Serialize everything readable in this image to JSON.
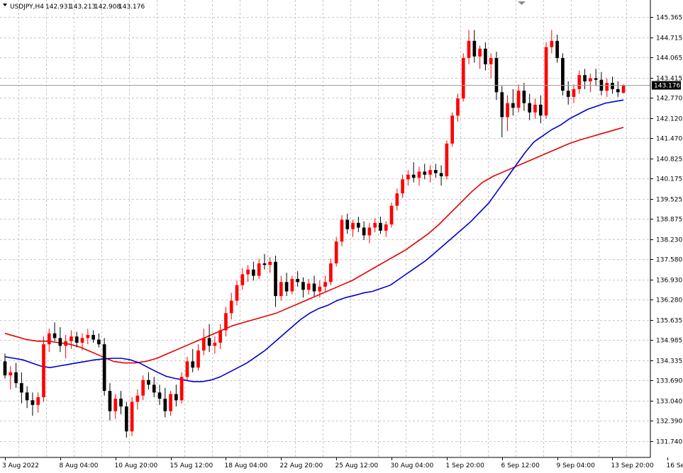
{
  "header": {
    "symbol": "USDJPY,H4",
    "open": "142.931",
    "high": "143.213",
    "low": "142.908",
    "close": "143.176"
  },
  "current_price_label": "143.176",
  "colors": {
    "background": "#ffffff",
    "grid": "#c8c8c8",
    "axis": "#000000",
    "bull_candle": "#ff0000",
    "bear_candle": "#000000",
    "ma_fast": "#0000cc",
    "ma_slow": "#e60000",
    "price_tag_bg": "#000000",
    "price_tag_text": "#ffffff"
  },
  "chart_data": {
    "type": "candlestick",
    "instrument": "USDJPY",
    "timeframe": "H4",
    "y_ticks": [
      "145.365",
      "144.715",
      "144.065",
      "143.415",
      "142.770",
      "142.120",
      "141.470",
      "140.825",
      "140.175",
      "139.525",
      "138.875",
      "138.230",
      "137.580",
      "136.930",
      "136.280",
      "135.635",
      "134.985",
      "134.335",
      "133.690",
      "133.040",
      "132.390",
      "131.740"
    ],
    "x_ticks": [
      "3 Aug 2022",
      "8 Aug 04:00",
      "10 Aug 20:00",
      "15 Aug 12:00",
      "18 Aug 04:00",
      "22 Aug 20:00",
      "25 Aug 12:00",
      "30 Aug 04:00",
      "1 Sep 20:00",
      "6 Sep 12:00",
      "9 Sep 04:00",
      "13 Sep 20:00",
      "16 Sep 12:00"
    ],
    "x_tick_bar_index": [
      0,
      10,
      20,
      30,
      40,
      50,
      60,
      70,
      80,
      90,
      100,
      110,
      120
    ],
    "ylim": [
      131.35,
      145.55
    ],
    "candles": [
      [
        134.3,
        134.55,
        133.75,
        133.85
      ],
      [
        133.85,
        134.15,
        133.4,
        133.95
      ],
      [
        133.95,
        134.25,
        133.45,
        133.6
      ],
      [
        133.6,
        133.95,
        132.95,
        133.3
      ],
      [
        133.3,
        133.5,
        132.8,
        133.05
      ],
      [
        133.05,
        133.3,
        132.55,
        132.9
      ],
      [
        132.9,
        133.3,
        132.65,
        133.15
      ],
      [
        133.15,
        135.1,
        133.0,
        134.85
      ],
      [
        134.85,
        135.35,
        134.6,
        135.2
      ],
      [
        135.2,
        135.55,
        134.95,
        135.05
      ],
      [
        135.05,
        135.4,
        134.6,
        134.8
      ],
      [
        134.8,
        135.15,
        134.4,
        134.95
      ],
      [
        134.95,
        135.3,
        134.7,
        135.1
      ],
      [
        135.1,
        135.25,
        134.75,
        134.9
      ],
      [
        134.9,
        135.2,
        134.65,
        135.05
      ],
      [
        135.05,
        135.35,
        134.85,
        135.15
      ],
      [
        135.15,
        135.3,
        134.9,
        135.0
      ],
      [
        135.0,
        135.2,
        134.75,
        134.85
      ],
      [
        134.85,
        135.05,
        133.2,
        133.35
      ],
      [
        133.35,
        133.6,
        132.4,
        132.7
      ],
      [
        132.7,
        133.25,
        132.45,
        133.1
      ],
      [
        133.1,
        133.35,
        132.6,
        132.85
      ],
      [
        132.85,
        133.0,
        131.85,
        132.05
      ],
      [
        132.05,
        133.15,
        131.9,
        133.0
      ],
      [
        133.0,
        133.4,
        132.75,
        133.2
      ],
      [
        133.2,
        133.85,
        133.05,
        133.7
      ],
      [
        133.7,
        133.95,
        133.4,
        133.55
      ],
      [
        133.55,
        133.8,
        133.15,
        133.3
      ],
      [
        133.3,
        133.55,
        132.9,
        133.1
      ],
      [
        133.1,
        133.45,
        132.5,
        132.7
      ],
      [
        132.7,
        133.35,
        132.55,
        133.25
      ],
      [
        133.25,
        133.55,
        132.85,
        133.05
      ],
      [
        133.05,
        133.95,
        132.95,
        133.8
      ],
      [
        133.8,
        134.45,
        133.7,
        134.3
      ],
      [
        134.3,
        134.7,
        133.95,
        134.1
      ],
      [
        134.1,
        134.85,
        134.0,
        134.65
      ],
      [
        134.65,
        135.35,
        134.5,
        135.05
      ],
      [
        135.05,
        135.5,
        134.6,
        134.8
      ],
      [
        134.8,
        135.1,
        134.55,
        134.9
      ],
      [
        134.9,
        135.5,
        134.7,
        135.3
      ],
      [
        135.3,
        136.05,
        135.1,
        135.85
      ],
      [
        135.85,
        136.5,
        135.65,
        136.25
      ],
      [
        136.25,
        136.9,
        136.1,
        136.75
      ],
      [
        136.75,
        137.3,
        136.6,
        137.1
      ],
      [
        137.1,
        137.4,
        136.85,
        137.25
      ],
      [
        137.25,
        137.5,
        136.9,
        137.05
      ],
      [
        137.05,
        137.6,
        136.95,
        137.45
      ],
      [
        137.45,
        137.75,
        137.25,
        137.4
      ],
      [
        137.4,
        137.65,
        137.15,
        137.5
      ],
      [
        137.5,
        137.7,
        136.05,
        136.4
      ],
      [
        136.4,
        137.05,
        136.25,
        136.85
      ],
      [
        136.85,
        137.15,
        136.4,
        136.55
      ],
      [
        136.55,
        137.05,
        136.45,
        136.95
      ],
      [
        136.95,
        137.2,
        136.7,
        136.85
      ],
      [
        136.85,
        137.0,
        136.35,
        136.6
      ],
      [
        136.6,
        136.95,
        136.45,
        136.8
      ],
      [
        136.8,
        137.05,
        136.4,
        136.55
      ],
      [
        136.55,
        136.9,
        136.35,
        136.7
      ],
      [
        136.7,
        137.05,
        136.55,
        136.85
      ],
      [
        136.85,
        137.6,
        136.75,
        137.45
      ],
      [
        137.45,
        138.3,
        137.35,
        138.15
      ],
      [
        138.15,
        139.0,
        138.0,
        138.85
      ],
      [
        138.85,
        139.05,
        138.4,
        138.55
      ],
      [
        138.55,
        138.85,
        138.3,
        138.75
      ],
      [
        138.75,
        138.95,
        138.45,
        138.6
      ],
      [
        138.6,
        138.8,
        138.2,
        138.35
      ],
      [
        138.35,
        138.75,
        138.1,
        138.6
      ],
      [
        138.6,
        138.9,
        138.45,
        138.75
      ],
      [
        138.75,
        138.95,
        138.4,
        138.5
      ],
      [
        138.5,
        138.8,
        138.3,
        138.7
      ],
      [
        138.7,
        139.4,
        138.6,
        139.3
      ],
      [
        139.3,
        139.85,
        139.15,
        139.7
      ],
      [
        139.7,
        140.3,
        139.55,
        140.15
      ],
      [
        140.15,
        140.45,
        139.95,
        140.3
      ],
      [
        140.3,
        140.7,
        140.05,
        140.2
      ],
      [
        140.2,
        140.55,
        139.95,
        140.4
      ],
      [
        140.4,
        140.65,
        140.15,
        140.3
      ],
      [
        140.3,
        140.6,
        140.05,
        140.45
      ],
      [
        140.45,
        140.65,
        140.2,
        140.35
      ],
      [
        140.35,
        140.6,
        139.95,
        140.25
      ],
      [
        140.25,
        141.4,
        140.15,
        141.3
      ],
      [
        141.3,
        142.3,
        141.2,
        142.2
      ],
      [
        142.2,
        142.9,
        142.0,
        142.75
      ],
      [
        142.75,
        144.2,
        142.65,
        144.05
      ],
      [
        144.05,
        144.95,
        143.85,
        144.6
      ],
      [
        144.6,
        144.95,
        143.9,
        144.1
      ],
      [
        144.1,
        144.45,
        143.7,
        144.35
      ],
      [
        144.35,
        144.55,
        143.65,
        143.85
      ],
      [
        143.85,
        144.2,
        143.4,
        144.05
      ],
      [
        144.05,
        144.25,
        142.7,
        142.95
      ],
      [
        142.95,
        143.15,
        141.5,
        142.15
      ],
      [
        142.15,
        142.85,
        141.7,
        142.6
      ],
      [
        142.6,
        143.05,
        142.2,
        142.45
      ],
      [
        142.45,
        143.2,
        142.3,
        143.0
      ],
      [
        143.0,
        143.25,
        142.35,
        142.6
      ],
      [
        142.6,
        142.9,
        142.05,
        142.3
      ],
      [
        142.3,
        142.75,
        142.1,
        142.55
      ],
      [
        142.55,
        142.85,
        141.95,
        142.2
      ],
      [
        142.2,
        144.55,
        142.1,
        144.4
      ],
      [
        144.4,
        144.95,
        144.2,
        144.6
      ],
      [
        144.6,
        144.8,
        143.9,
        144.05
      ],
      [
        144.05,
        144.2,
        142.85,
        143.0
      ],
      [
        143.0,
        143.3,
        142.55,
        142.8
      ],
      [
        142.8,
        143.2,
        142.6,
        143.05
      ],
      [
        143.05,
        143.65,
        142.9,
        143.5
      ],
      [
        143.5,
        143.7,
        143.05,
        143.3
      ],
      [
        143.3,
        143.55,
        142.95,
        143.4
      ],
      [
        143.4,
        143.7,
        143.15,
        143.35
      ],
      [
        143.35,
        143.6,
        142.85,
        143.0
      ],
      [
        143.0,
        143.4,
        142.8,
        143.25
      ],
      [
        143.25,
        143.45,
        142.9,
        143.05
      ],
      [
        143.05,
        143.3,
        142.8,
        142.95
      ],
      [
        142.93,
        143.21,
        142.91,
        143.18
      ]
    ],
    "ma_fast_name": "",
    "ma_slow_name": "",
    "ma_fast": [
      134.45,
      134.4,
      134.35,
      134.25,
      134.15,
      134.1,
      134.15,
      134.2,
      134.25,
      134.3,
      134.35,
      134.38,
      134.4,
      134.4,
      134.35,
      134.25,
      134.1,
      133.95,
      133.82,
      133.75,
      133.7,
      133.65,
      133.65,
      133.7,
      133.8,
      133.95,
      134.1,
      134.25,
      134.45,
      134.65,
      134.9,
      135.15,
      135.4,
      135.65,
      135.85,
      136.0,
      136.1,
      136.25,
      136.35,
      136.42,
      136.5,
      136.55,
      136.65,
      136.75,
      136.95,
      137.15,
      137.35,
      137.55,
      137.8,
      138.05,
      138.3,
      138.55,
      138.8,
      139.1,
      139.4,
      139.8,
      140.2,
      140.6,
      141.0,
      141.35,
      141.55,
      141.75,
      141.9,
      142.1,
      142.25,
      142.4,
      142.5,
      142.6,
      142.65,
      142.7
    ],
    "ma_slow": [
      135.2,
      135.1,
      135.0,
      134.95,
      134.95,
      134.9,
      134.85,
      134.75,
      134.6,
      134.45,
      134.3,
      134.25,
      134.25,
      134.3,
      134.4,
      134.55,
      134.7,
      134.85,
      135.0,
      135.15,
      135.3,
      135.45,
      135.55,
      135.65,
      135.75,
      135.85,
      136.0,
      136.15,
      136.3,
      136.45,
      136.6,
      136.75,
      136.9,
      137.1,
      137.3,
      137.5,
      137.7,
      137.9,
      138.15,
      138.4,
      138.7,
      139.05,
      139.4,
      139.75,
      140.05,
      140.25,
      140.4,
      140.55,
      140.7,
      140.85,
      141.0,
      141.15,
      141.3,
      141.42,
      141.52,
      141.62,
      141.72,
      141.82
    ]
  }
}
